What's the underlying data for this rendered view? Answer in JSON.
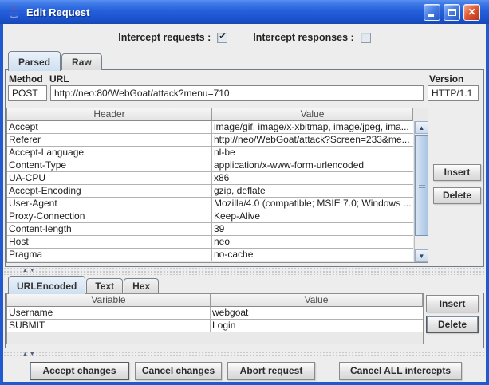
{
  "window": {
    "title": "Edit Request",
    "icon": "java-coffee-cup"
  },
  "intercept": {
    "requests_label": "Intercept requests :",
    "requests_checked": true,
    "responses_label": "Intercept responses :",
    "responses_checked": false
  },
  "request_tabs": [
    {
      "label": "Parsed",
      "selected": true
    },
    {
      "label": "Raw",
      "selected": false
    }
  ],
  "request_line": {
    "method_label": "Method",
    "method": "POST",
    "url_label": "URL",
    "url": "http://neo:80/WebGoat/attack?menu=710",
    "version_label": "Version",
    "version": "HTTP/1.1"
  },
  "headers_table": {
    "columns": [
      "Header",
      "Value"
    ],
    "rows": [
      [
        "Accept",
        "image/gif, image/x-xbitmap, image/jpeg, ima..."
      ],
      [
        "Referer",
        "http://neo/WebGoat/attack?Screen=233&me..."
      ],
      [
        "Accept-Language",
        "nl-be"
      ],
      [
        "Content-Type",
        "application/x-www-form-urlencoded"
      ],
      [
        "UA-CPU",
        "x86"
      ],
      [
        "Accept-Encoding",
        "gzip, deflate"
      ],
      [
        "User-Agent",
        "Mozilla/4.0 (compatible; MSIE 7.0; Windows ..."
      ],
      [
        "Proxy-Connection",
        "Keep-Alive"
      ],
      [
        "Content-length",
        "39"
      ],
      [
        "Host",
        "neo"
      ],
      [
        "Pragma",
        "no-cache"
      ]
    ],
    "insert_label": "Insert",
    "delete_label": "Delete"
  },
  "content_tabs": [
    {
      "label": "URLEncoded",
      "selected": true
    },
    {
      "label": "Text",
      "selected": false
    },
    {
      "label": "Hex",
      "selected": false
    }
  ],
  "params_table": {
    "columns": [
      "Variable",
      "Value"
    ],
    "rows": [
      [
        "Username",
        "webgoat"
      ],
      [
        "SUBMIT",
        "Login"
      ]
    ],
    "insert_label": "Insert",
    "delete_label": "Delete"
  },
  "actions": {
    "accept": "Accept changes",
    "cancel": "Cancel changes",
    "abort": "Abort request",
    "cancel_all": "Cancel ALL intercepts"
  },
  "icons": {
    "scroll_up": "▲",
    "scroll_down": "▼",
    "divider_arrows": "▲▼",
    "check": "✔"
  },
  "colors": {
    "titlebar1": "#3F7BE8",
    "titlebar2": "#1A52CC",
    "win_border": "#2159D1",
    "content_bg": "#EDEDED",
    "tab_sel": "#CFDFF0",
    "grid": "#B2B2B2"
  }
}
